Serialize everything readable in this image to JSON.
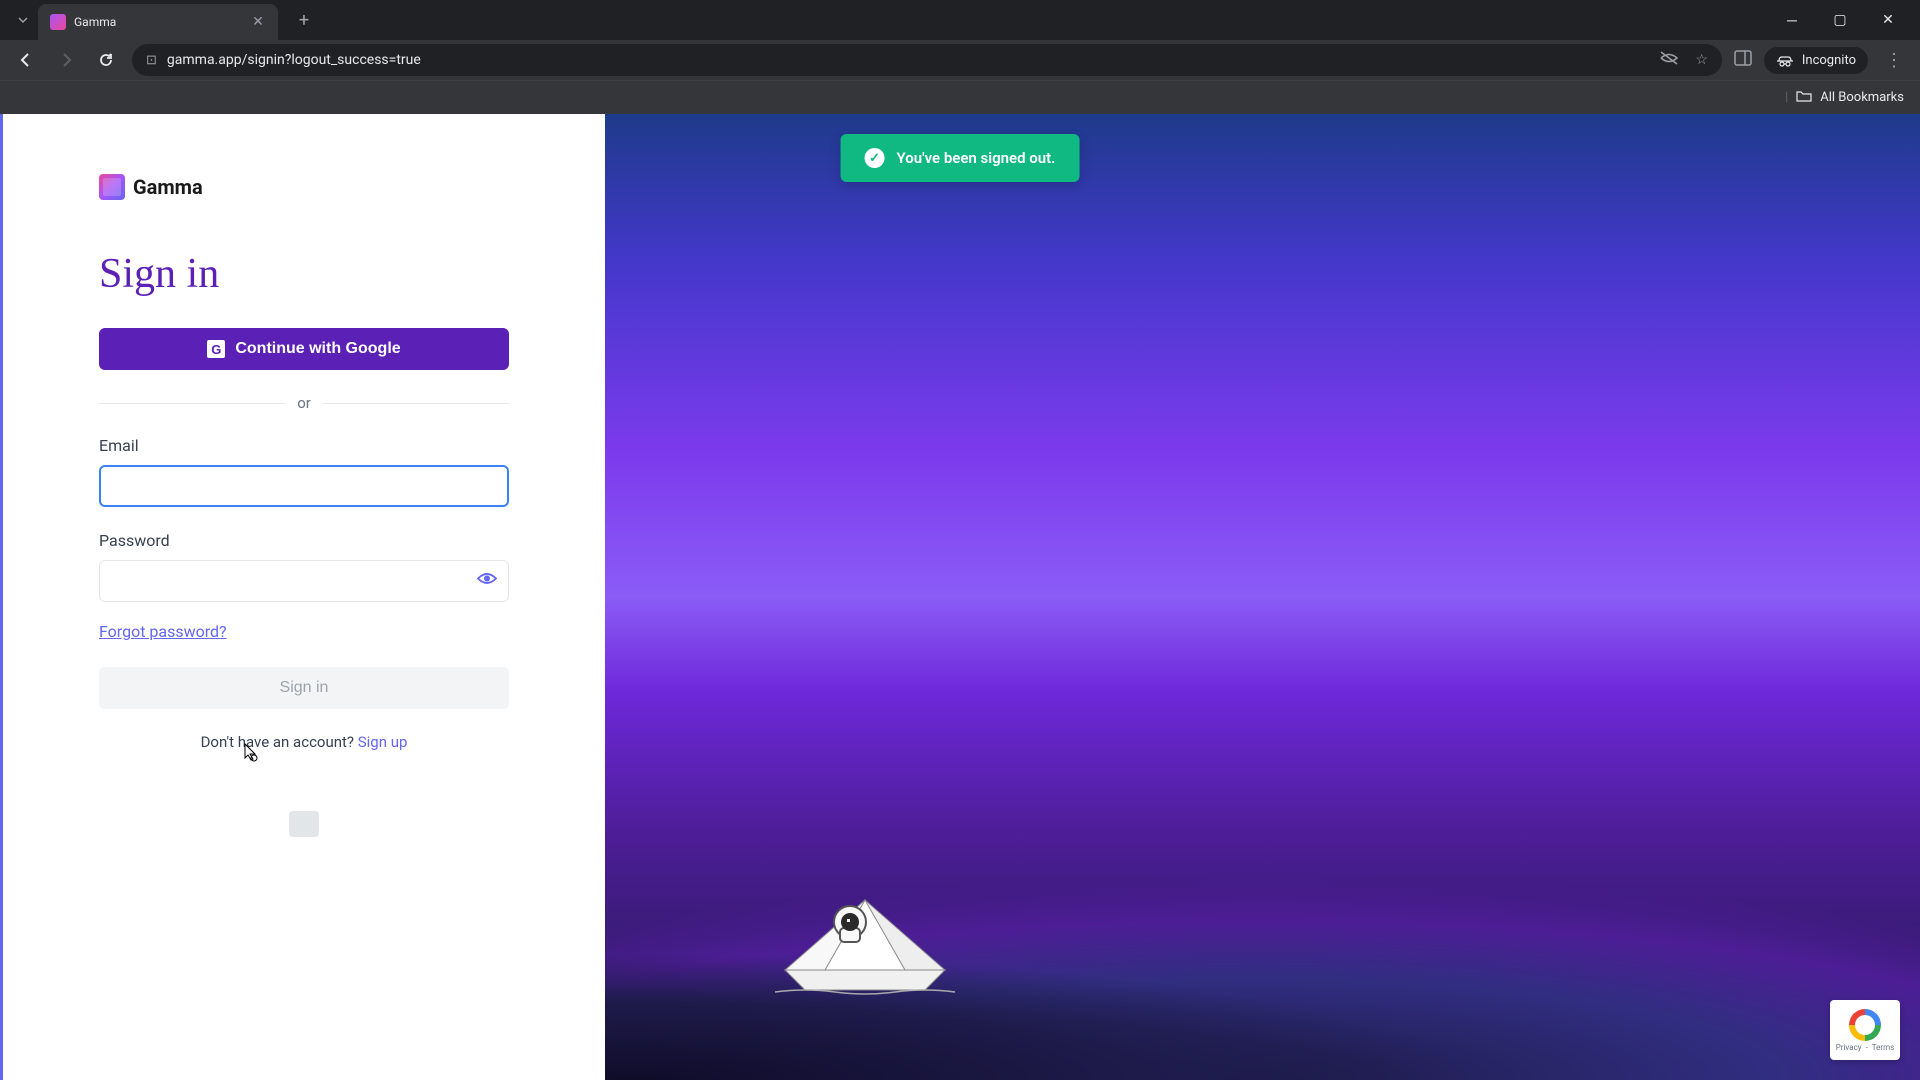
{
  "browser": {
    "tab_title": "Gamma",
    "url": "gamma.app/signin?logout_success=true",
    "incognito_label": "Incognito",
    "all_bookmarks": "All Bookmarks"
  },
  "toast": {
    "message": "You've been signed out."
  },
  "logo": {
    "text": "Gamma"
  },
  "form": {
    "title": "Sign in",
    "google_button": "Continue with Google",
    "divider": "or",
    "email_label": "Email",
    "email_value": "",
    "password_label": "Password",
    "password_value": "",
    "forgot_password": "Forgot password?",
    "signin_button": "Sign in",
    "signup_prompt": "Don't have an account? ",
    "signup_link": "Sign up"
  },
  "recaptcha": {
    "line1": "Privacy",
    "line2": "Terms"
  }
}
